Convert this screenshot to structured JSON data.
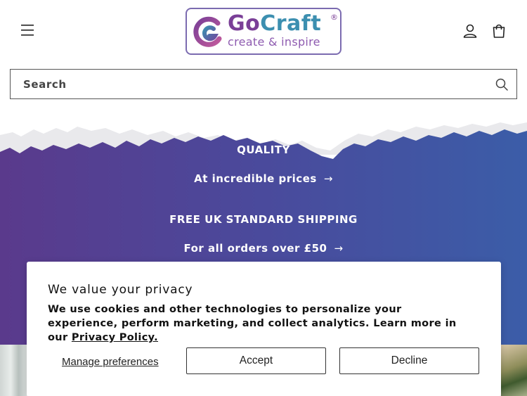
{
  "header": {
    "logo": {
      "name_part1": "Go",
      "name_part2": "Craft",
      "registered": "®",
      "tagline": "create & inspire"
    },
    "icons": [
      "hamburger-menu-icon",
      "account-icon",
      "cart-icon"
    ]
  },
  "search": {
    "placeholder": "Search"
  },
  "hero": {
    "line1": "QUALITY",
    "line2": "At incredible prices",
    "line3": "FREE UK STANDARD SHIPPING",
    "line4": "For all orders over £50",
    "arrow": "→",
    "colors": {
      "gradient_start": "#5a3a8c",
      "gradient_end": "#3b5da8"
    }
  },
  "cookie_banner": {
    "title": "We value your privacy",
    "body": "We use cookies and other technologies to personalize your experience, perform marketing, and collect analytics. Learn more in our ",
    "link_text": "Privacy Policy.",
    "manage_label": "Manage preferences",
    "accept_label": "Accept",
    "decline_label": "Decline"
  }
}
